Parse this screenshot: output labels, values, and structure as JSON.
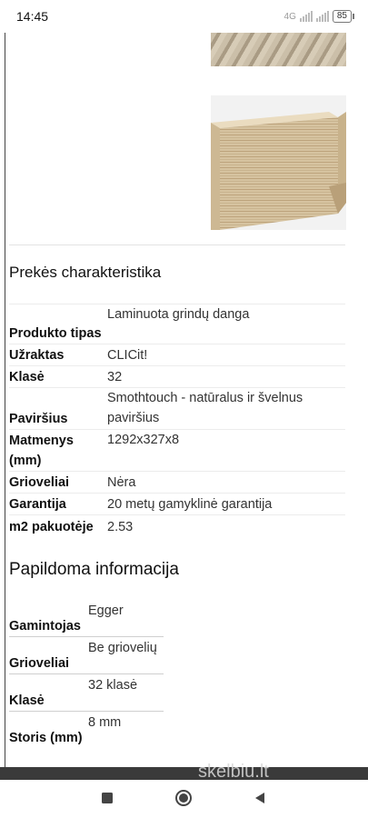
{
  "status_bar": {
    "time": "14:45",
    "network": "4G",
    "battery": "85"
  },
  "specs": {
    "title": "Prekės charakteristika",
    "rows": [
      {
        "label": "Produkto tipas",
        "value": "Laminuota grindų danga"
      },
      {
        "label": "Užraktas",
        "value": "CLICit!"
      },
      {
        "label": "Klasė",
        "value": "32"
      },
      {
        "label": "Paviršius",
        "value": "Smothtouch - natūralus ir švelnus paviršius"
      },
      {
        "label": "Matmenys (mm)",
        "value": "1292x327x8"
      },
      {
        "label": "Grioveliai",
        "value": "Nėra"
      },
      {
        "label": "Garantija",
        "value": "20 metų gamyklinė garantija"
      },
      {
        "label": "m2 pakuotėje",
        "value": "2.53"
      }
    ]
  },
  "additional": {
    "title": "Papildoma informacija",
    "rows": [
      {
        "label": "Gamintojas",
        "value": "Egger"
      },
      {
        "label": "Grioveliai",
        "value": "Be griovelių"
      },
      {
        "label": "Klasė",
        "value": "32 klasė"
      },
      {
        "label": "Storis (mm)",
        "value": "8 mm"
      }
    ]
  },
  "footer": {
    "watermark": "skelbiu.lt"
  },
  "colors": {
    "footer_bar": "#3a3a3a",
    "wood_light": "#d9c7a4",
    "wood_dark": "#b89d72"
  },
  "icons": [
    "square-icon",
    "circle-icon",
    "back-triangle-icon"
  ]
}
